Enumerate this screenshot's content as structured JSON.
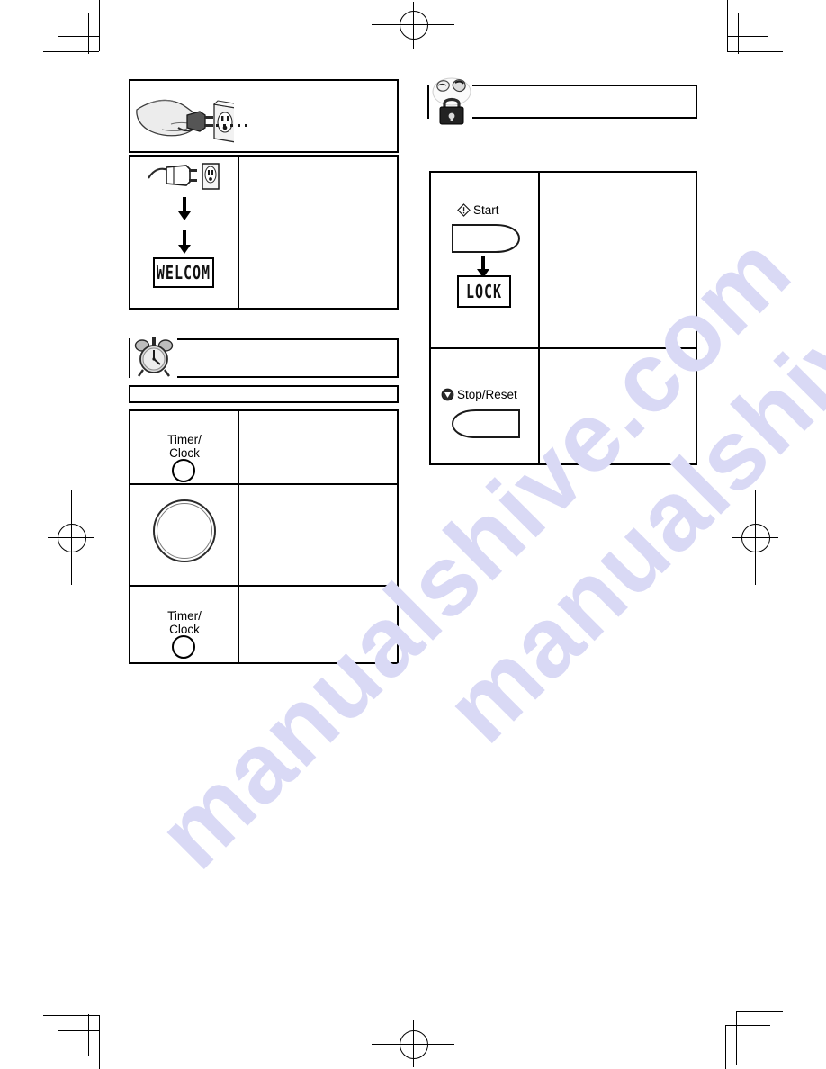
{
  "page": {
    "background": "#ffffff",
    "watermark_text": "manualshive.com",
    "watermark_color": "#d9d9f5"
  },
  "printer_marks": {
    "corner_crop_marks": [
      "top-left",
      "top-right",
      "bottom-left",
      "bottom-right"
    ],
    "registration_marks": [
      "top-center",
      "left-center",
      "right-center",
      "bottom-center"
    ]
  },
  "left_column": {
    "plug_panel": {
      "illustration_name": "hand-plugging-cord-into-outlet",
      "trailing_dots": "....."
    },
    "plug_table": {
      "left_cell": {
        "illustration_name": "plug-and-outlet",
        "arrow_1": "down-arrow",
        "arrow_2": "down-arrow",
        "display_text": "WELCOM"
      },
      "right_cell": {
        "text": ""
      }
    },
    "clock_banner": {
      "icon_name": "alarm-clock-icon",
      "heading": ""
    },
    "clock_subbar": {
      "text": ""
    },
    "clock_table": {
      "rows": [
        {
          "control_label_line1": "Timer/",
          "control_label_line2": "Clock",
          "control_type": "round-button",
          "description": ""
        },
        {
          "control_label_line1": "",
          "control_label_line2": "",
          "control_type": "dial-knob",
          "description": ""
        },
        {
          "control_label_line1": "Timer/",
          "control_label_line2": "Clock",
          "control_type": "round-button",
          "description": ""
        }
      ]
    }
  },
  "right_column": {
    "child_lock_banner": {
      "icon_name": "child-lock-padlock-icon",
      "heading": ""
    },
    "lock_table": {
      "rows": [
        {
          "button_label": "Start",
          "button_icon_name": "start-diamond-icon",
          "button_shape": "paddle-right",
          "arrow": "down-arrow",
          "display_text": "LOCK",
          "description": ""
        },
        {
          "button_label": "Stop/Reset",
          "button_icon_name": "stop-reset-circle-icon",
          "button_shape": "paddle-left",
          "arrow": "",
          "display_text": "",
          "description": ""
        }
      ]
    }
  }
}
